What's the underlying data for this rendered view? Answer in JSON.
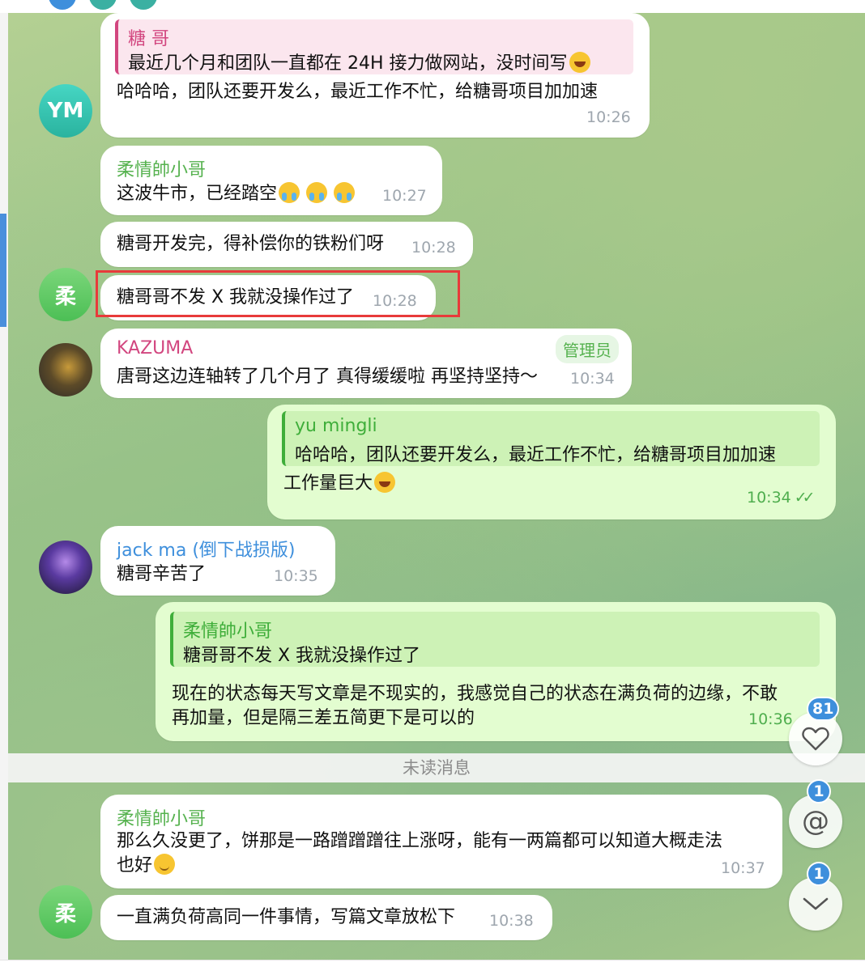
{
  "messages": {
    "m1": {
      "reply_name": "糖 哥",
      "reply_text": "最近几个月和团队一直都在 24H 接力做网站，没时间写",
      "text": "哈哈哈，团队还要开发么，最近工作不忙，给糖哥项目加加速",
      "time": "10:26",
      "avatar_initials": "YM"
    },
    "m2": {
      "name": "柔情帥小哥",
      "text": "这波牛市，已经踏空",
      "time": "10:27"
    },
    "m3": {
      "text": "糖哥开发完，得补偿你的铁粉们呀",
      "time": "10:28"
    },
    "m4": {
      "text": "糖哥哥不发 X 我就没操作过了",
      "time": "10:28",
      "avatar_initials": "柔"
    },
    "m5": {
      "name": "KAZUMA",
      "tag": "管理员",
      "text": "唐哥这边连轴转了几个月了 真得缓缓啦 再坚持坚持～",
      "time": "10:34"
    },
    "m6": {
      "reply_name": "yu mingli",
      "reply_text": "哈哈哈，团队还要开发么，最近工作不忙，给糖哥项目加加速",
      "text": "工作量巨大",
      "time": "10:34"
    },
    "m7": {
      "name": "jack ma (倒下战损版)",
      "text": "糖哥辛苦了",
      "time": "10:35"
    },
    "m8": {
      "reply_name": "柔情帥小哥",
      "reply_text": "糖哥哥不发 X 我就没操作过了",
      "line1": "现在的状态每天写文章是不现实的，我感觉自己的状态在满负荷的边缘，不敢",
      "line2": "再加量，但是隔三差五简更下是可以的",
      "time": "10:36"
    },
    "m9": {
      "name": "柔情帥小哥",
      "line1": "那么久没更了，饼那是一路蹭蹭蹭往上涨呀，能有一两篇都可以知道大概走法",
      "line2": "也好",
      "time": "10:37"
    },
    "m10": {
      "text": "一直满负荷高同一件事情，写篇文章放松下",
      "time": "10:38",
      "avatar_initials": "柔"
    }
  },
  "unread_divider": "未读消息",
  "fabs": {
    "reactions_badge": "81",
    "mentions_badge": "1",
    "scroll_badge": "1"
  },
  "colors": {
    "accent_green": "#56b24f",
    "link_blue": "#3e8fdc",
    "pink_name": "#d2467f",
    "outgoing_bubble": "#e3fdd0",
    "highlight_red": "#e83a3a"
  }
}
